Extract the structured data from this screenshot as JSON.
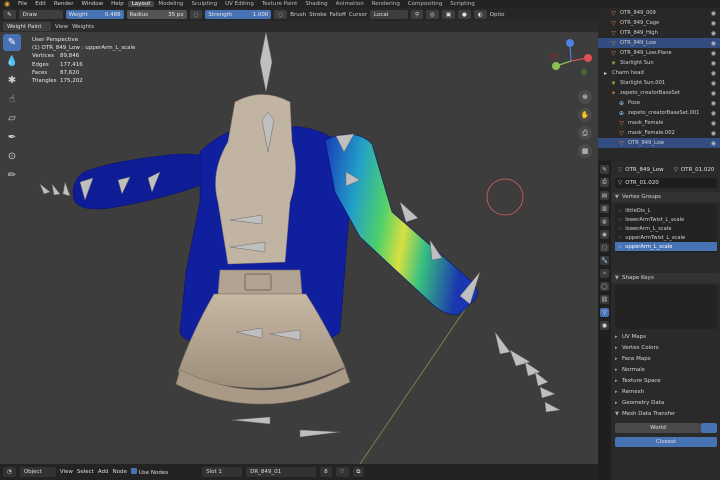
{
  "menu": {
    "items": [
      "File",
      "Edit",
      "Render",
      "Window",
      "Help"
    ],
    "workspaces": [
      "Layout",
      "Modeling",
      "Sculpting",
      "UV Editing",
      "Texture Paint",
      "Shading",
      "Animation",
      "Rendering",
      "Compositing",
      "Scripting"
    ],
    "active_workspace": "Layout"
  },
  "header": {
    "mode": "Weight Paint",
    "view": "View",
    "weights": "Weights",
    "brush_name": "Draw",
    "weight_label": "Weight",
    "weight_value": "0.488",
    "radius_label": "Radius",
    "radius_value": "35 px",
    "strength_label": "Strength",
    "strength_value": "1.000",
    "brush_menu": "Brush",
    "stroke_menu": "Stroke",
    "falloff_menu": "Falloff",
    "cursor_menu": "Cursor",
    "orientation": "Local",
    "options": "Optio"
  },
  "viewport": {
    "perspective": "User Perspective",
    "object_info": "(1) OTR_849_Low : upperArm_L_scale",
    "stats": [
      {
        "label": "Vertices",
        "value": "89,846"
      },
      {
        "label": "Edges",
        "value": "177,416"
      },
      {
        "label": "Faces",
        "value": "87,620"
      },
      {
        "label": "Triangles",
        "value": "175,202"
      }
    ]
  },
  "statusbar": {
    "mode": "Object",
    "view": "View",
    "select": "Select",
    "add": "Add",
    "node": "Node",
    "use_nodes": "Use Nodes",
    "slot": "Slot 1",
    "material": "DR_849_01",
    "users": "8"
  },
  "outliner": {
    "rows": [
      {
        "name": "OTR_849_009",
        "icon": "▽",
        "color": "#e07b39",
        "selected": false,
        "indent": 1
      },
      {
        "name": "OTR_849_Cage",
        "icon": "▽",
        "color": "#e07b39",
        "selected": false,
        "indent": 1
      },
      {
        "name": "OTR_849_High",
        "icon": "▽",
        "color": "#e07b39",
        "selected": false,
        "indent": 1
      },
      {
        "name": "OTR_849_Low",
        "icon": "▽",
        "color": "#e07b39",
        "selected": true,
        "indent": 1
      },
      {
        "name": "OTR_849_Low.Plane",
        "icon": "▽",
        "color": "#e07b39",
        "selected": false,
        "indent": 1
      },
      {
        "name": "Starlight Sun",
        "icon": "☀",
        "color": "#e8c84a",
        "selected": false,
        "indent": 1
      },
      {
        "name": "Charm head",
        "icon": "▸",
        "color": "#cccccc",
        "selected": false,
        "indent": 0
      },
      {
        "name": "Starlight Sun.001",
        "icon": "☀",
        "color": "#e8c84a",
        "selected": false,
        "indent": 1
      },
      {
        "name": "zepeto_creatorBaseSet",
        "icon": "✦",
        "color": "#e07b39",
        "selected": false,
        "indent": 1
      },
      {
        "name": "Pose",
        "icon": "⊕",
        "color": "#9ec8e8",
        "selected": false,
        "indent": 2
      },
      {
        "name": "zepeto_creatorBaseSet.001",
        "icon": "⊕",
        "color": "#9ec8e8",
        "selected": false,
        "indent": 2
      },
      {
        "name": "mask_Female",
        "icon": "▽",
        "color": "#e07b39",
        "selected": false,
        "indent": 2
      },
      {
        "name": "mask_Female.002",
        "icon": "▽",
        "color": "#e07b39",
        "selected": false,
        "indent": 2
      },
      {
        "name": "OTR_849_Low",
        "icon": "▽",
        "color": "#e07b39",
        "selected": true,
        "indent": 2
      }
    ]
  },
  "properties": {
    "object_name": "OTR_849_Low",
    "mesh_name": "OTR_01.020",
    "data_field": "OTR_01.020",
    "vertex_groups_title": "Vertex Groups",
    "vertex_groups": [
      {
        "name": "littleDis_L",
        "selected": false
      },
      {
        "name": "lowerArmTwist_L_scale",
        "selected": false
      },
      {
        "name": "lowerArm_L_scale",
        "selected": false
      },
      {
        "name": "upperArmTwist_L_scale",
        "selected": false
      },
      {
        "name": "upperArm_L_scale",
        "selected": true
      }
    ],
    "shape_keys": "Shape Keys",
    "sections": [
      "UV Maps",
      "Vertex Colors",
      "Face Maps",
      "Normals",
      "Texture Space",
      "Remesh",
      "Geometry Data",
      "Mesh Data Transfer"
    ],
    "world_button": "World",
    "closest_button": "Closest"
  }
}
